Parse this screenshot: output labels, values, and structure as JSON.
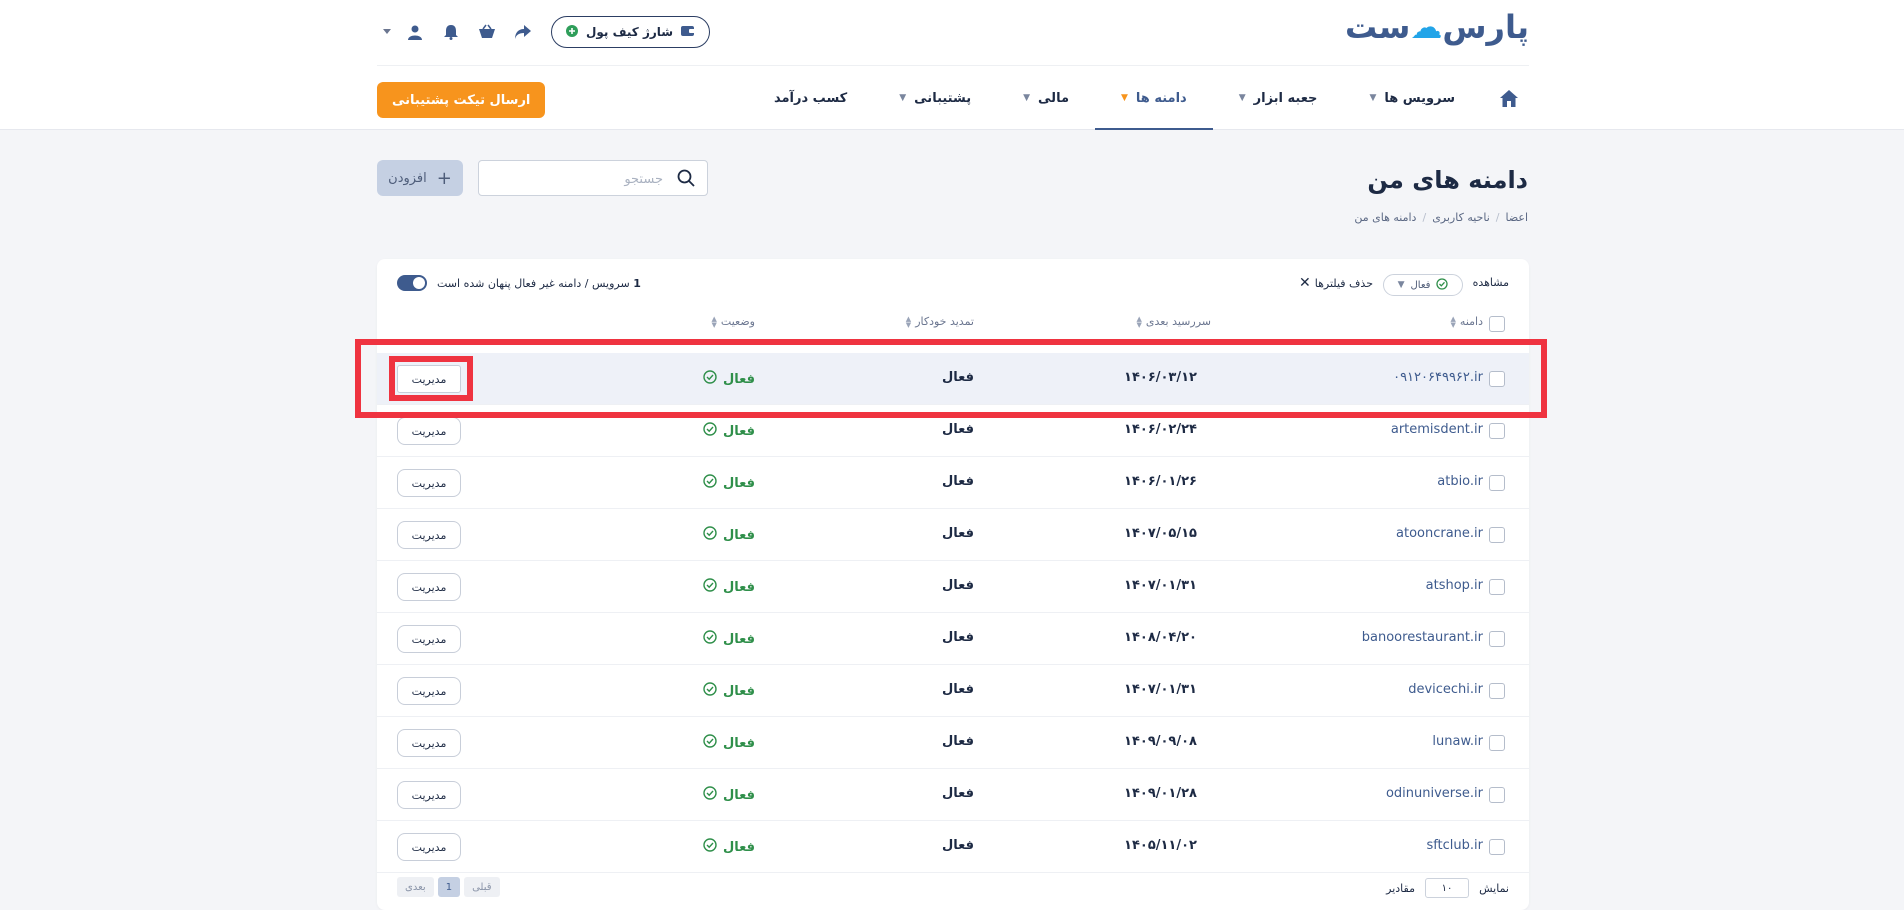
{
  "brand": {
    "logo_part1": "پارس",
    "logo_part2": "ست",
    "accent": "#22a4e8",
    "primary": "#3e5b8e"
  },
  "topbar": {
    "wallet_label": "شارژ کیف پول",
    "icons": [
      "wallet-icon",
      "plus-circle-icon",
      "share-icon",
      "basket-icon",
      "bell-icon",
      "user-icon",
      "chevron-down-icon"
    ]
  },
  "nav": {
    "items": [
      {
        "label": "سرویس ها",
        "caret": true
      },
      {
        "label": "جعبه ابزار",
        "caret": true
      },
      {
        "label": "دامنه ها",
        "caret": true,
        "active": true
      },
      {
        "label": "مالی",
        "caret": true
      },
      {
        "label": "پشتیبانی",
        "caret": true
      },
      {
        "label": "کسب درآمد",
        "caret": false
      }
    ],
    "ticket_label": "ارسال تیکت پشتیبانی",
    "ticket_color": "#f7941d"
  },
  "page": {
    "title": "دامنه های من",
    "breadcrumb": [
      "اعضا",
      "ناحیه کاربری",
      "دامنه های من"
    ],
    "search_placeholder": "جستجو",
    "add_label": "افزودن"
  },
  "filters": {
    "view_label": "مشاهده",
    "selected": "فعال",
    "clear_label": "حذف فیلترها",
    "hidden_count": "1",
    "hidden_text": "سرویس / دامنه غیر فعال پنهان شده است"
  },
  "table": {
    "columns": [
      "دامنه",
      "سررسید بعدی",
      "تمدید خودکار",
      "وضعیت"
    ],
    "manage_label": "مدیریت",
    "rows": [
      {
        "domain": "۰۹۱۲۰۶۴۹۹۶۲.ir",
        "expiry": "۱۴۰۶/۰۳/۱۲",
        "renew": "فعال",
        "status": "فعال",
        "selected": true
      },
      {
        "domain": "artemisdent.ir",
        "expiry": "۱۴۰۶/۰۲/۲۴",
        "renew": "فعال",
        "status": "فعال"
      },
      {
        "domain": "atbio.ir",
        "expiry": "۱۴۰۶/۰۱/۲۶",
        "renew": "فعال",
        "status": "فعال"
      },
      {
        "domain": "atooncrane.ir",
        "expiry": "۱۴۰۷/۰۵/۱۵",
        "renew": "فعال",
        "status": "فعال"
      },
      {
        "domain": "atshop.ir",
        "expiry": "۱۴۰۷/۰۱/۳۱",
        "renew": "فعال",
        "status": "فعال"
      },
      {
        "domain": "banoorestaurant.ir",
        "expiry": "۱۴۰۸/۰۴/۲۰",
        "renew": "فعال",
        "status": "فعال"
      },
      {
        "domain": "devicechi.ir",
        "expiry": "۱۴۰۷/۰۱/۳۱",
        "renew": "فعال",
        "status": "فعال"
      },
      {
        "domain": "lunaw.ir",
        "expiry": "۱۴۰۹/۰۹/۰۸",
        "renew": "فعال",
        "status": "فعال"
      },
      {
        "domain": "odinuniverse.ir",
        "expiry": "۱۴۰۹/۰۱/۲۸",
        "renew": "فعال",
        "status": "فعال"
      },
      {
        "domain": "sftclub.ir",
        "expiry": "۱۴۰۵/۱۱/۰۲",
        "renew": "فعال",
        "status": "فعال"
      }
    ]
  },
  "footer": {
    "show_label": "نمایش",
    "per_page": "۱۰",
    "values_label": "مقادیر",
    "prev_label": "قبلی",
    "current_page": "1",
    "next_label": "بعدی"
  },
  "status_color": "#2f8f4a",
  "highlight_color": "#ef3340"
}
